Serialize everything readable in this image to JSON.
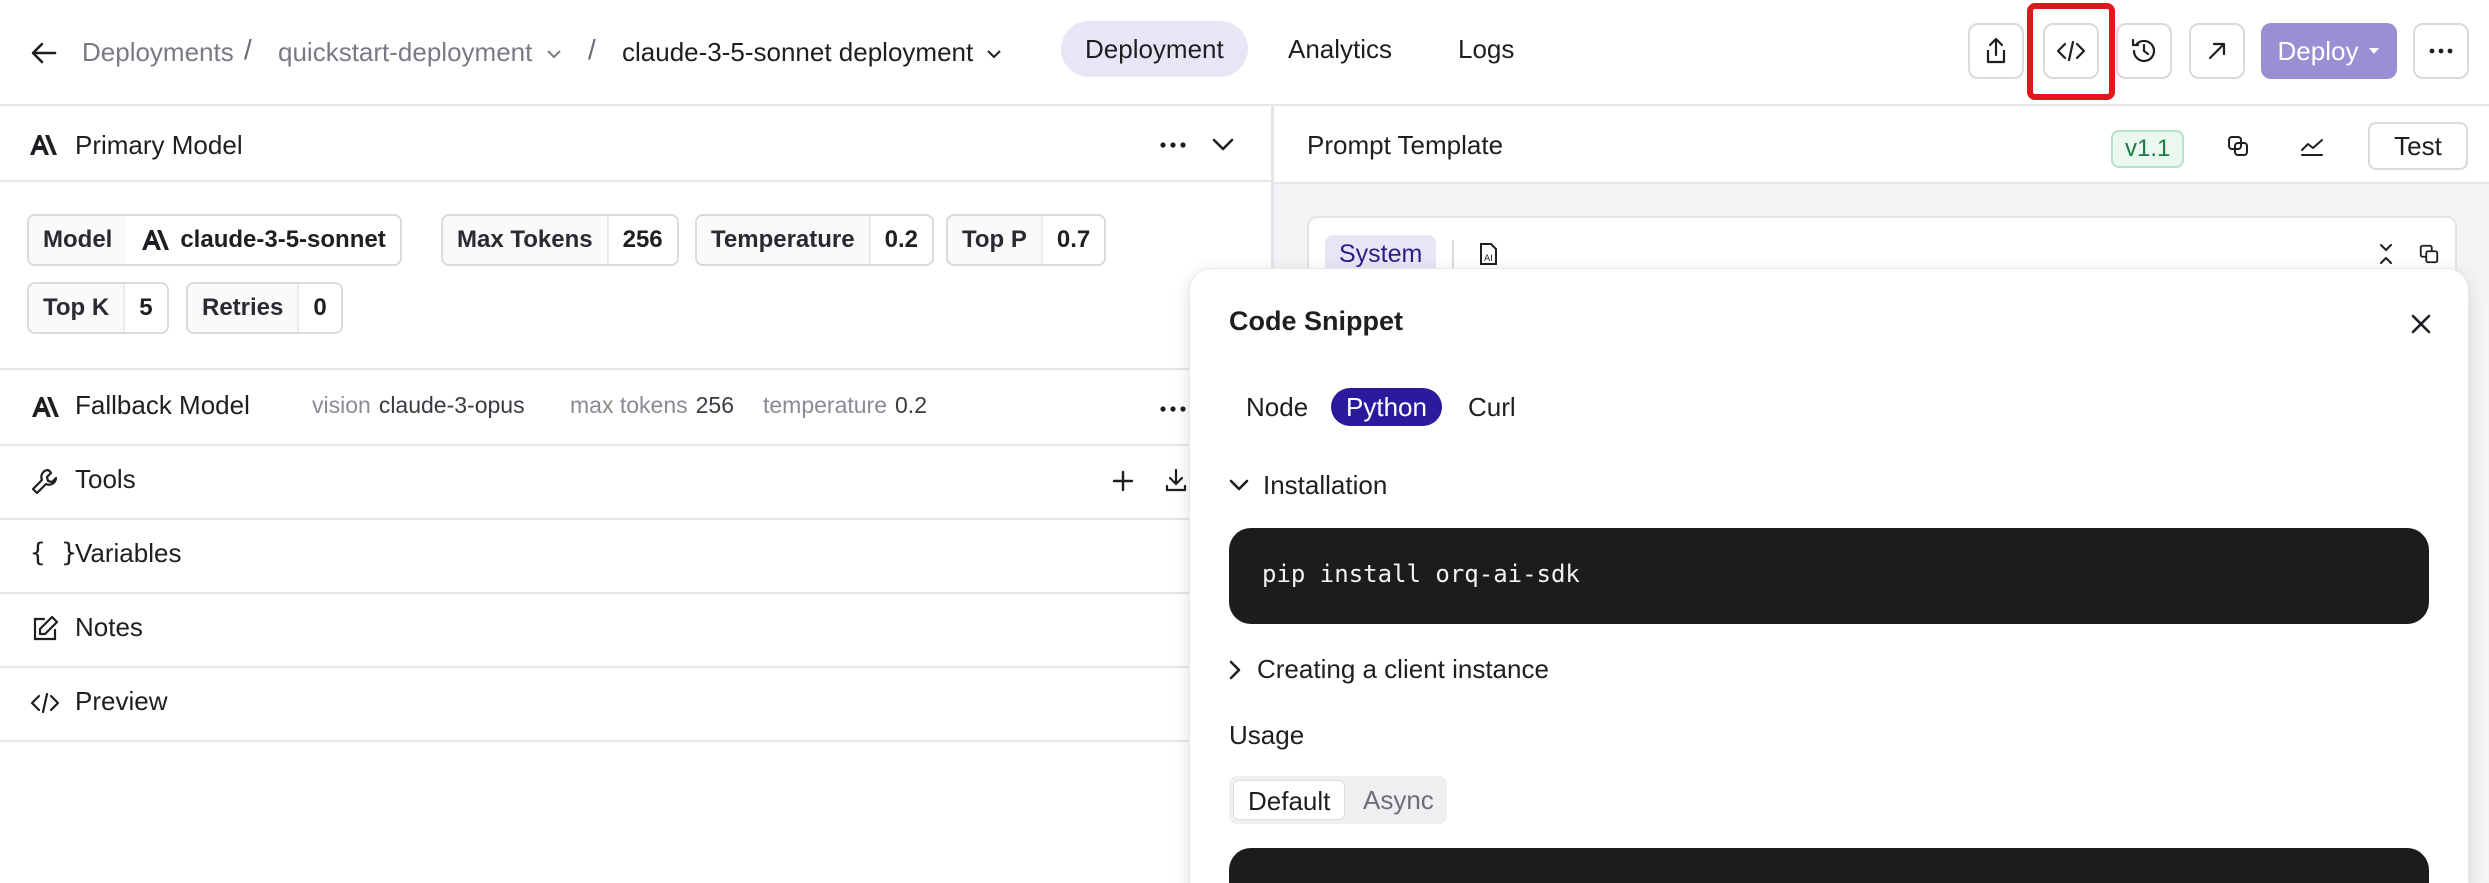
{
  "breadcrumb": {
    "root": "Deployments",
    "separator": "/",
    "project": "quickstart-deployment",
    "current": "claude-3-5-sonnet deployment"
  },
  "nav_tabs": [
    {
      "label": "Deployment",
      "active": true
    },
    {
      "label": "Analytics",
      "active": false
    },
    {
      "label": "Logs",
      "active": false
    }
  ],
  "toolbar": {
    "icons": [
      "share-icon",
      "code-icon",
      "history-icon",
      "external-link-icon",
      "more-icon"
    ],
    "deploy_label": "Deploy",
    "accent": "#9b8ed3",
    "highlight_color": "#e5151b"
  },
  "primary_model": {
    "title": "Primary Model",
    "params": [
      {
        "key": "Model",
        "value": "claude-3-5-sonnet"
      },
      {
        "key": "Max Tokens",
        "value": "256"
      },
      {
        "key": "Temperature",
        "value": "0.2"
      },
      {
        "key": "Top P",
        "value": "0.7"
      },
      {
        "key": "Top K",
        "value": "5"
      },
      {
        "key": "Retries",
        "value": "0"
      }
    ]
  },
  "fallback_model": {
    "title": "Fallback Model",
    "meta": [
      {
        "label": "vision",
        "value": "claude-3-opus"
      },
      {
        "label": "max tokens",
        "value": "256"
      },
      {
        "label": "temperature",
        "value": "0.2"
      }
    ]
  },
  "sections": [
    {
      "label": "Tools",
      "icon": "wrench-icon"
    },
    {
      "label": "Variables",
      "icon": "braces-icon"
    },
    {
      "label": "Notes",
      "icon": "edit-icon"
    },
    {
      "label": "Preview",
      "icon": "code-icon"
    }
  ],
  "prompt_template": {
    "title": "Prompt Template",
    "version": "v1.1",
    "test_label": "Test",
    "system_tag": "System"
  },
  "code_snippet": {
    "title": "Code Snippet",
    "languages": [
      {
        "label": "Node",
        "active": false
      },
      {
        "label": "Python",
        "active": true
      },
      {
        "label": "Curl",
        "active": false
      }
    ],
    "installation_label": "Installation",
    "install_command": "pip install orq-ai-sdk",
    "client_label": "Creating a client instance",
    "usage_label": "Usage",
    "usage_options": [
      {
        "label": "Default",
        "active": true
      },
      {
        "label": "Async",
        "active": false
      }
    ]
  }
}
